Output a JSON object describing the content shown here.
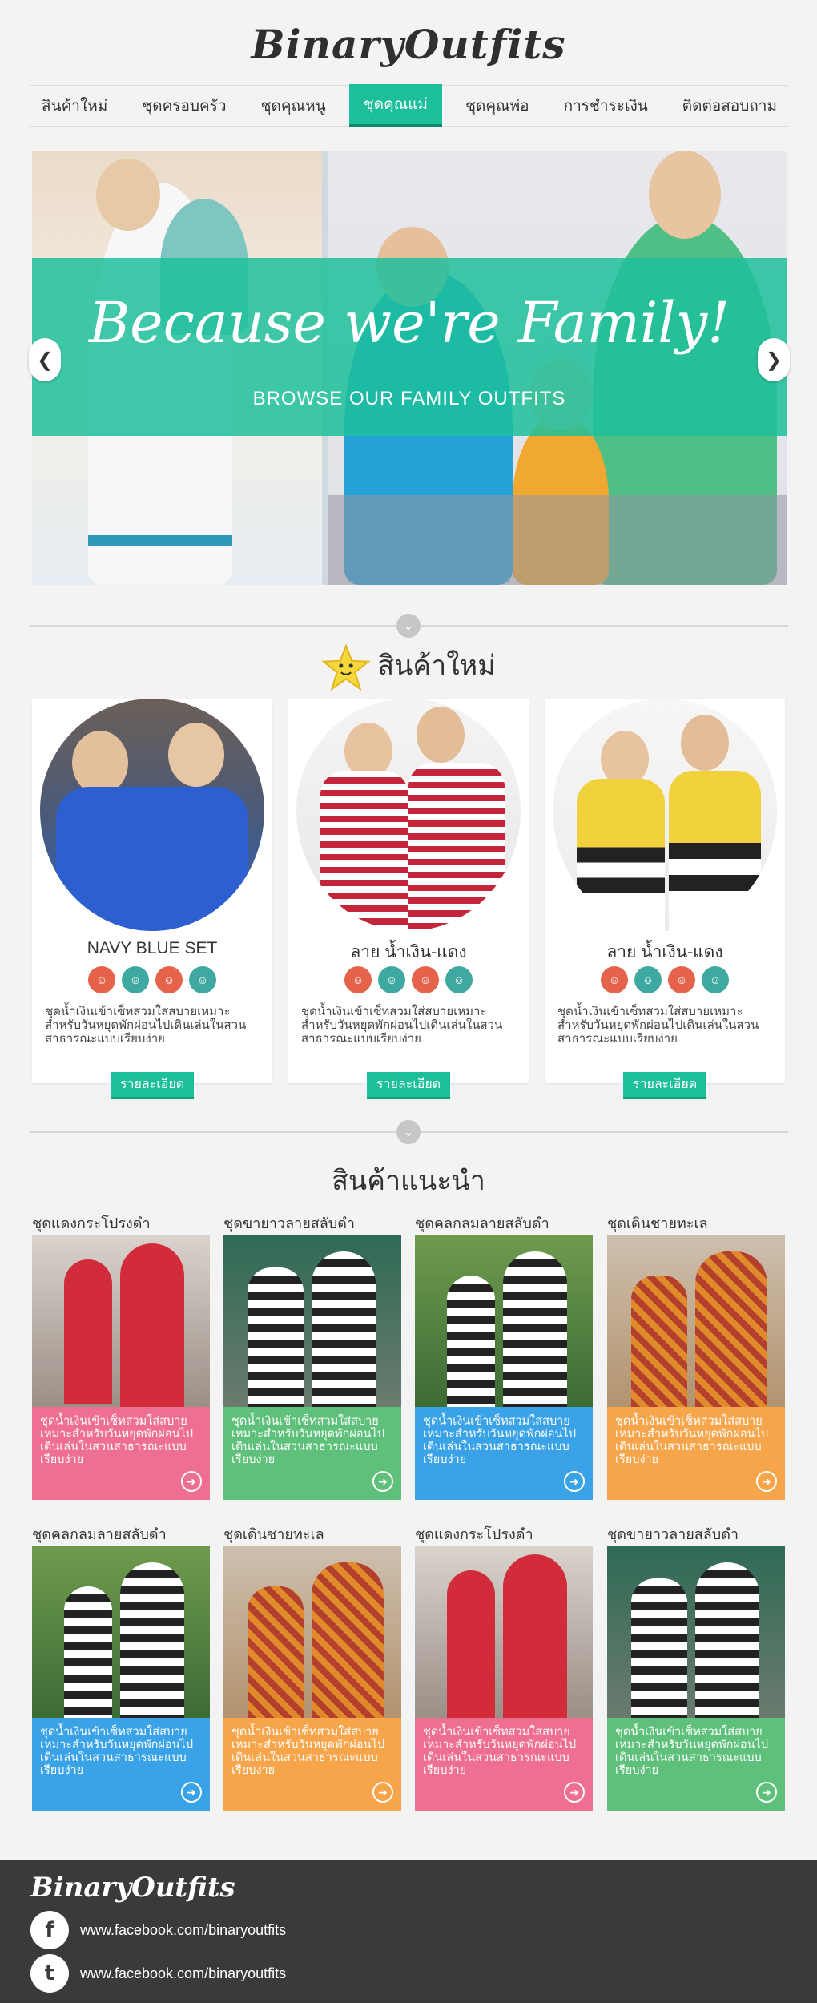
{
  "brand": {
    "logo": "BinaryOutfits"
  },
  "nav": [
    {
      "label": "สินค้าใหม่"
    },
    {
      "label": "ชุดครอบครัว"
    },
    {
      "label": "ชุดคุณหนู"
    },
    {
      "label": "ชุดคุณแม่",
      "active": true
    },
    {
      "label": "ชุดคุณพ่อ"
    },
    {
      "label": "การชำระเงิน"
    },
    {
      "label": "ติดต่อสอบถาม"
    }
  ],
  "hero": {
    "title": "Because we're Family!",
    "subtitle": "BROWSE OUR FAMILY OUTFITS",
    "prev_icon": "chevron-left-icon",
    "next_icon": "chevron-right-icon"
  },
  "new_products": {
    "title": "สินค้าใหม่",
    "icon": "star-icon",
    "items": [
      {
        "name": "NAVY BLUE SET",
        "description": "ชุดน้ำเงินเข้าเซ็ทสวมใส่สบายเหมาะสำหรับวันหยุดพักผ่อนไปเดินเล่นในสวนสาธารณะแบบเรียบง่าย",
        "button": "รายละเอียด"
      },
      {
        "name": "ลาย น้ำเงิน-แดง",
        "description": "ชุดน้ำเงินเข้าเซ็ทสวมใส่สบายเหมาะสำหรับวันหยุดพักผ่อนไปเดินเล่นในสวนสาธารณะแบบเรียบง่าย",
        "button": "รายละเอียด"
      },
      {
        "name": "ลาย น้ำเงิน-แดง",
        "description": "ชุดน้ำเงินเข้าเซ็ทสวมใส่สบายเหมาะสำหรับวันหยุดพักผ่อนไปเดินเล่นในสวนสาธารณะแบบเรียบง่าย",
        "button": "รายละเอียด"
      }
    ]
  },
  "recommended": {
    "title": "สินค้าแนะนำ",
    "items": [
      {
        "title": "ชุดแดงกระโปรงดำ",
        "description": "ชุดน้ำเงินเข้าเซ็ทสวมใส่สบายเหมาะสำหรับวันหยุดพักผ่อนไปเดินเล่นในสวนสาธารณะแบบเรียบง่าย",
        "color": "#ee6f8f"
      },
      {
        "title": "ชุดขายาวลายสลับดำ",
        "description": "ชุดน้ำเงินเข้าเซ็ทสวมใส่สบายเหมาะสำหรับวันหยุดพักผ่อนไปเดินเล่นในสวนสาธารณะแบบเรียบง่าย",
        "color": "#5ec07a"
      },
      {
        "title": "ชุดคลกลมลายสลับดำ",
        "description": "ชุดน้ำเงินเข้าเซ็ทสวมใส่สบายเหมาะสำหรับวันหยุดพักผ่อนไปเดินเล่นในสวนสาธารณะแบบเรียบง่าย",
        "color": "#3aa2e6"
      },
      {
        "title": "ชุดเดินชายทะเล",
        "description": "ชุดน้ำเงินเข้าเซ็ทสวมใส่สบายเหมาะสำหรับวันหยุดพักผ่อนไปเดินเล่นในสวนสาธารณะแบบเรียบง่าย",
        "color": "#f6a54a"
      },
      {
        "title": "ชุดคลกลมลายสลับดำ",
        "description": "ชุดน้ำเงินเข้าเซ็ทสวมใส่สบายเหมาะสำหรับวันหยุดพักผ่อนไปเดินเล่นในสวนสาธารณะแบบเรียบง่าย",
        "color": "#3aa2e6"
      },
      {
        "title": "ชุดเดินชายทะเล",
        "description": "ชุดน้ำเงินเข้าเซ็ทสวมใส่สบายเหมาะสำหรับวันหยุดพักผ่อนไปเดินเล่นในสวนสาธารณะแบบเรียบง่าย",
        "color": "#f6a54a"
      },
      {
        "title": "ชุดแดงกระโปรงดำ",
        "description": "ชุดน้ำเงินเข้าเซ็ทสวมใส่สบายเหมาะสำหรับวันหยุดพักผ่อนไปเดินเล่นในสวนสาธารณะแบบเรียบง่าย",
        "color": "#ee6f8f"
      },
      {
        "title": "ชุดขายาวลายสลับดำ",
        "description": "ชุดน้ำเงินเข้าเซ็ทสวมใส่สบายเหมาะสำหรับวันหยุดพักผ่อนไปเดินเล่นในสวนสาธารณะแบบเรียบง่าย",
        "color": "#5ec07a"
      }
    ]
  },
  "footer": {
    "logo": "BinaryOutfits",
    "links": [
      {
        "icon": "facebook-icon",
        "glyph": "f",
        "text": "www.facebook.com/binaryoutfits"
      },
      {
        "icon": "twitter-icon",
        "glyph": "t",
        "text": "www.facebook.com/binaryoutfits"
      }
    ]
  },
  "colors": {
    "accent": "#1dbf9b",
    "footer_bg": "#3a3a3a"
  }
}
